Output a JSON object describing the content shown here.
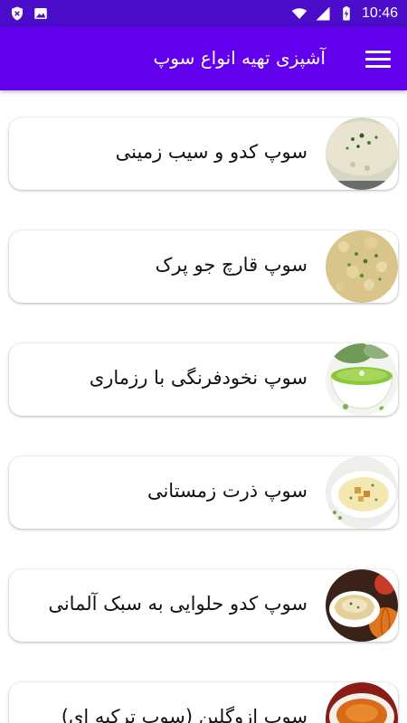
{
  "status_bar": {
    "time": "10:46",
    "left_icons": [
      "shield-x-icon",
      "image-icon"
    ],
    "right_icons": [
      "wifi-icon",
      "signal-icon",
      "battery-charging-icon"
    ]
  },
  "app_bar": {
    "title": "آشپزی تهیه انواع سوپ",
    "menu_icon": "menu-icon",
    "color": "#6200ee",
    "status_color": "#4b0dc9"
  },
  "items": [
    {
      "label": "سوپ کدو و سیب زمینی",
      "thumb": "creamy-soup-thumbnail"
    },
    {
      "label": "سوپ قارچ جو پرک",
      "thumb": "barley-soup-thumbnail"
    },
    {
      "label": "سوپ نخودفرنگی با رزماری",
      "thumb": "pea-soup-thumbnail"
    },
    {
      "label": "سوپ ذرت زمستانی",
      "thumb": "corn-soup-thumbnail"
    },
    {
      "label": "سوپ کدو حلوایی به سبک آلمانی",
      "thumb": "pumpkin-soup-thumbnail"
    },
    {
      "label": "سوپ ازوگلین (سوپ ترکیه ای)",
      "thumb": "ezogelin-soup-thumbnail"
    }
  ]
}
